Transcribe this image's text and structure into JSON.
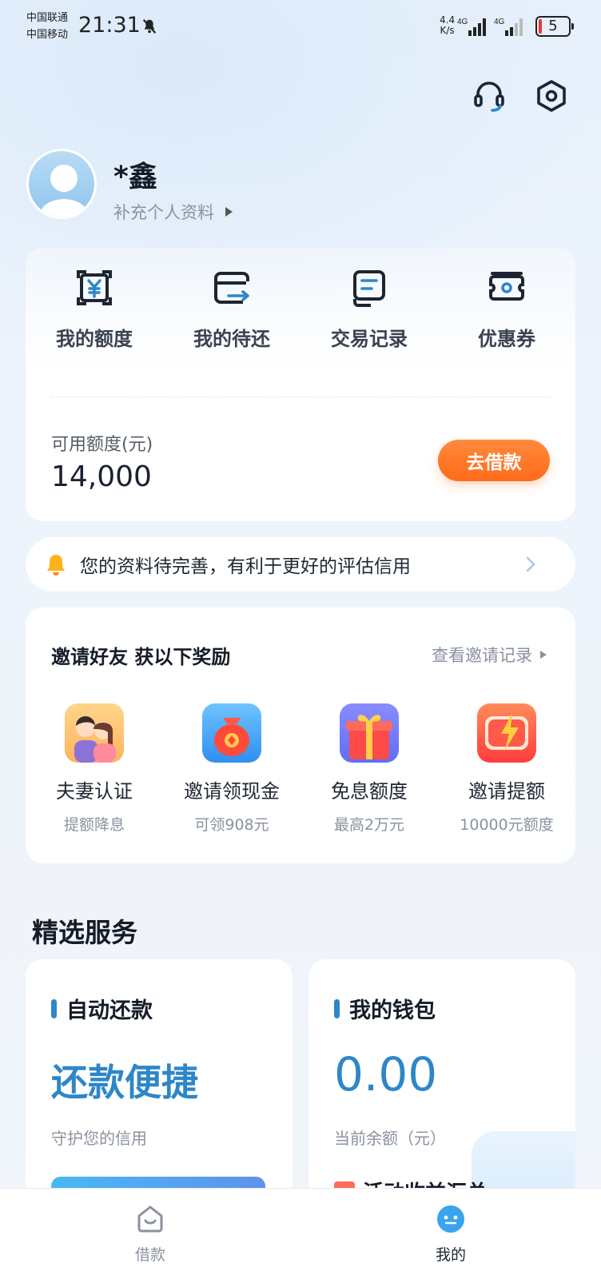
{
  "status_bar": {
    "carrier_1": "中国联通",
    "carrier_2": "中国移动",
    "time": "21:31",
    "net_speed_value": "4.4",
    "net_speed_unit": "K/s",
    "network_type": "4G",
    "battery_level": "5"
  },
  "profile": {
    "name": "*鑫",
    "link_label": "补充个人资料"
  },
  "quick_actions": [
    {
      "label": "我的额度",
      "icon": "yuan-quota-icon"
    },
    {
      "label": "我的待还",
      "icon": "card-repay-icon"
    },
    {
      "label": "交易记录",
      "icon": "record-icon"
    },
    {
      "label": "优惠券",
      "icon": "coupon-icon"
    }
  ],
  "credit": {
    "available_label": "可用额度(元)",
    "available_value": "14,000",
    "borrow_button": "去借款"
  },
  "notice": {
    "text": "您的资料待完善，有利于更好的评估信用"
  },
  "invite": {
    "title": "邀请好友 获以下奖励",
    "record_link": "查看邀请记录",
    "rewards": [
      {
        "name": "夫妻认证",
        "sub": "提额降息",
        "icon": "couple-icon"
      },
      {
        "name": "邀请领现金",
        "sub": "可领908元",
        "icon": "money-bag-icon"
      },
      {
        "name": "免息额度",
        "sub": "最高2万元",
        "icon": "gift-box-icon"
      },
      {
        "name": "邀请提额",
        "sub": "10000元额度",
        "icon": "boost-icon"
      }
    ]
  },
  "services": {
    "section_title": "精选服务",
    "auto_repay": {
      "title": "自动还款",
      "headline": "还款便捷",
      "desc": "守护您的信用"
    },
    "wallet": {
      "title": "我的钱包",
      "balance": "0.00",
      "desc": "当前余额（元）",
      "peek_label": "活动收益汇总"
    }
  },
  "tabbar": {
    "tabs": [
      {
        "label": "借款",
        "active": false
      },
      {
        "label": "我的",
        "active": true
      }
    ]
  },
  "colors": {
    "accent_blue": "#2e86c8",
    "orange": "#ff6a1a",
    "text_dark": "#151c28",
    "text_gray": "#8a929e"
  }
}
